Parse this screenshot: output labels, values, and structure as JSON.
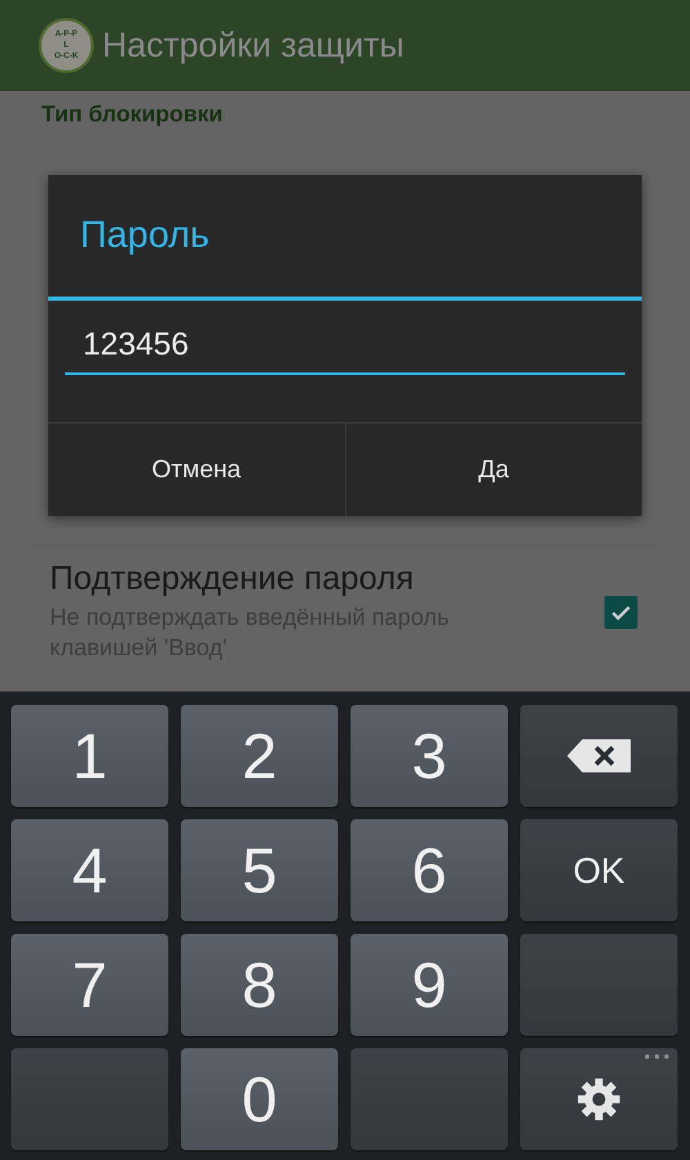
{
  "app_bar": {
    "title": "Настройки защиты",
    "logo": {
      "top": "A-P-P",
      "middle": "L",
      "bottom": "O-C-K"
    }
  },
  "settings": {
    "section_header": "Тип блокировки",
    "items": [
      {
        "title": "Подтверждение пароля",
        "summary": "Не подтверждать введённый пароль клавишей 'Ввод'",
        "checked": true
      }
    ]
  },
  "dialog": {
    "title": "Пароль",
    "field": {
      "value": "123456"
    },
    "buttons": [
      "Отмена",
      "Да"
    ]
  },
  "keyboard": {
    "keys": [
      {
        "kind": "digit",
        "label": "1"
      },
      {
        "kind": "digit",
        "label": "2"
      },
      {
        "kind": "digit",
        "label": "3"
      },
      {
        "kind": "backspace"
      },
      {
        "kind": "digit",
        "label": "4"
      },
      {
        "kind": "digit",
        "label": "5"
      },
      {
        "kind": "digit",
        "label": "6"
      },
      {
        "kind": "text",
        "label": "OK"
      },
      {
        "kind": "digit",
        "label": "7"
      },
      {
        "kind": "digit",
        "label": "8"
      },
      {
        "kind": "digit",
        "label": "9"
      },
      {
        "kind": "blank"
      },
      {
        "kind": "blank"
      },
      {
        "kind": "digit",
        "label": "0"
      },
      {
        "kind": "blank"
      },
      {
        "kind": "settings",
        "more": true
      }
    ]
  }
}
